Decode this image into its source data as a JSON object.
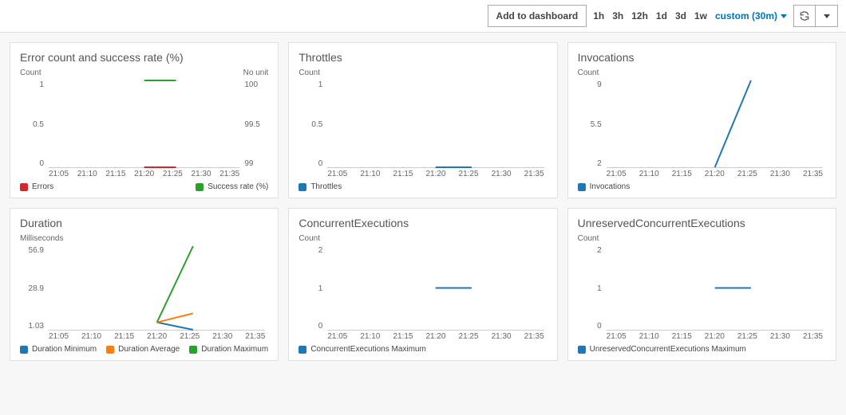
{
  "toolbar": {
    "add_to_dashboard": "Add to dashboard",
    "ranges": [
      "1h",
      "3h",
      "12h",
      "1d",
      "3d",
      "1w"
    ],
    "custom_label": "custom (30m)"
  },
  "x_ticks": [
    "21:05",
    "21:10",
    "21:15",
    "21:20",
    "21:25",
    "21:30",
    "21:35"
  ],
  "colors": {
    "blue": "#1f77b4",
    "green": "#2ca02c",
    "orange": "#ff7f0e",
    "red": "#d62728"
  },
  "cards": {
    "error_success": {
      "title": "Error count and success rate (%)",
      "y_left_label": "Count",
      "y_right_label": "No unit",
      "y_left_ticks": [
        "1",
        "0.5",
        "0"
      ],
      "y_right_ticks": [
        "100",
        "99.5",
        "99"
      ],
      "legend": [
        {
          "label": "Errors",
          "color": "red"
        },
        {
          "label": "Success rate (%)",
          "color": "green"
        }
      ]
    },
    "throttles": {
      "title": "Throttles",
      "y_label": "Count",
      "y_ticks": [
        "1",
        "0.5",
        "0"
      ],
      "legend": [
        {
          "label": "Throttles",
          "color": "blue"
        }
      ]
    },
    "invocations": {
      "title": "Invocations",
      "y_label": "Count",
      "y_ticks": [
        "9",
        "5.5",
        "2"
      ],
      "legend": [
        {
          "label": "Invocations",
          "color": "blue"
        }
      ]
    },
    "duration": {
      "title": "Duration",
      "y_label": "Milliseconds",
      "y_ticks": [
        "56.9",
        "28.9",
        "1.03"
      ],
      "legend": [
        {
          "label": "Duration Minimum",
          "color": "blue"
        },
        {
          "label": "Duration Average",
          "color": "orange"
        },
        {
          "label": "Duration Maximum",
          "color": "green"
        }
      ]
    },
    "concurrent": {
      "title": "ConcurrentExecutions",
      "y_label": "Count",
      "y_ticks": [
        "2",
        "1",
        "0"
      ],
      "legend": [
        {
          "label": "ConcurrentExecutions Maximum",
          "color": "blue"
        }
      ]
    },
    "unreserved_concurrent": {
      "title": "UnreservedConcurrentExecutions",
      "y_label": "Count",
      "y_ticks": [
        "2",
        "1",
        "0"
      ],
      "legend": [
        {
          "label": "UnreservedConcurrentExecutions Maximum",
          "color": "blue"
        }
      ]
    }
  },
  "chart_data": [
    {
      "id": "error_success",
      "type": "line",
      "x": [
        "21:05",
        "21:10",
        "21:15",
        "21:20",
        "21:25",
        "21:30",
        "21:35"
      ],
      "y_left_range": [
        0,
        1
      ],
      "y_right_range": [
        99,
        100
      ],
      "series": [
        {
          "name": "Errors",
          "axis": "left",
          "x": [
            "21:20",
            "21:25"
          ],
          "values": [
            0,
            0
          ]
        },
        {
          "name": "Success rate (%)",
          "axis": "right",
          "x": [
            "21:20",
            "21:25"
          ],
          "values": [
            100,
            100
          ]
        }
      ]
    },
    {
      "id": "throttles",
      "type": "line",
      "x": [
        "21:05",
        "21:10",
        "21:15",
        "21:20",
        "21:25",
        "21:30",
        "21:35"
      ],
      "y_range": [
        0,
        1
      ],
      "series": [
        {
          "name": "Throttles",
          "x": [
            "21:20",
            "21:25"
          ],
          "values": [
            0,
            0
          ]
        }
      ]
    },
    {
      "id": "invocations",
      "type": "line",
      "x": [
        "21:05",
        "21:10",
        "21:15",
        "21:20",
        "21:25",
        "21:30",
        "21:35"
      ],
      "y_range": [
        2,
        9
      ],
      "series": [
        {
          "name": "Invocations",
          "x": [
            "21:20",
            "21:25"
          ],
          "values": [
            2,
            9
          ]
        }
      ]
    },
    {
      "id": "duration",
      "type": "line",
      "x": [
        "21:05",
        "21:10",
        "21:15",
        "21:20",
        "21:25",
        "21:30",
        "21:35"
      ],
      "y_range": [
        1.03,
        56.9
      ],
      "series": [
        {
          "name": "Duration Minimum",
          "x": [
            "21:20",
            "21:25"
          ],
          "values": [
            6,
            1.03
          ]
        },
        {
          "name": "Duration Average",
          "x": [
            "21:20",
            "21:25"
          ],
          "values": [
            6,
            12
          ]
        },
        {
          "name": "Duration Maximum",
          "x": [
            "21:20",
            "21:25"
          ],
          "values": [
            6,
            56.9
          ]
        }
      ]
    },
    {
      "id": "concurrent",
      "type": "line",
      "x": [
        "21:05",
        "21:10",
        "21:15",
        "21:20",
        "21:25",
        "21:30",
        "21:35"
      ],
      "y_range": [
        0,
        2
      ],
      "series": [
        {
          "name": "ConcurrentExecutions Maximum",
          "x": [
            "21:20",
            "21:25"
          ],
          "values": [
            1,
            1
          ]
        }
      ]
    },
    {
      "id": "unreserved_concurrent",
      "type": "line",
      "x": [
        "21:05",
        "21:10",
        "21:15",
        "21:20",
        "21:25",
        "21:30",
        "21:35"
      ],
      "y_range": [
        0,
        2
      ],
      "series": [
        {
          "name": "UnreservedConcurrentExecutions Maximum",
          "x": [
            "21:20",
            "21:25"
          ],
          "values": [
            1,
            1
          ]
        }
      ]
    }
  ]
}
